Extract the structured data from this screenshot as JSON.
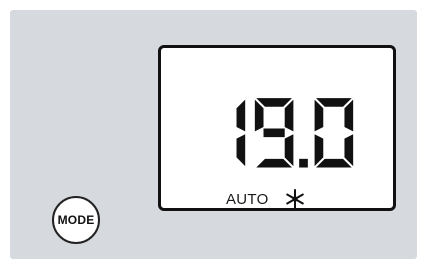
{
  "display": {
    "temperature": "19.0",
    "mode_text": "AUTO",
    "mode_icon": "snowflake-icon",
    "segment_color": "#111111"
  },
  "controls": {
    "mode_button_label": "MODE"
  }
}
